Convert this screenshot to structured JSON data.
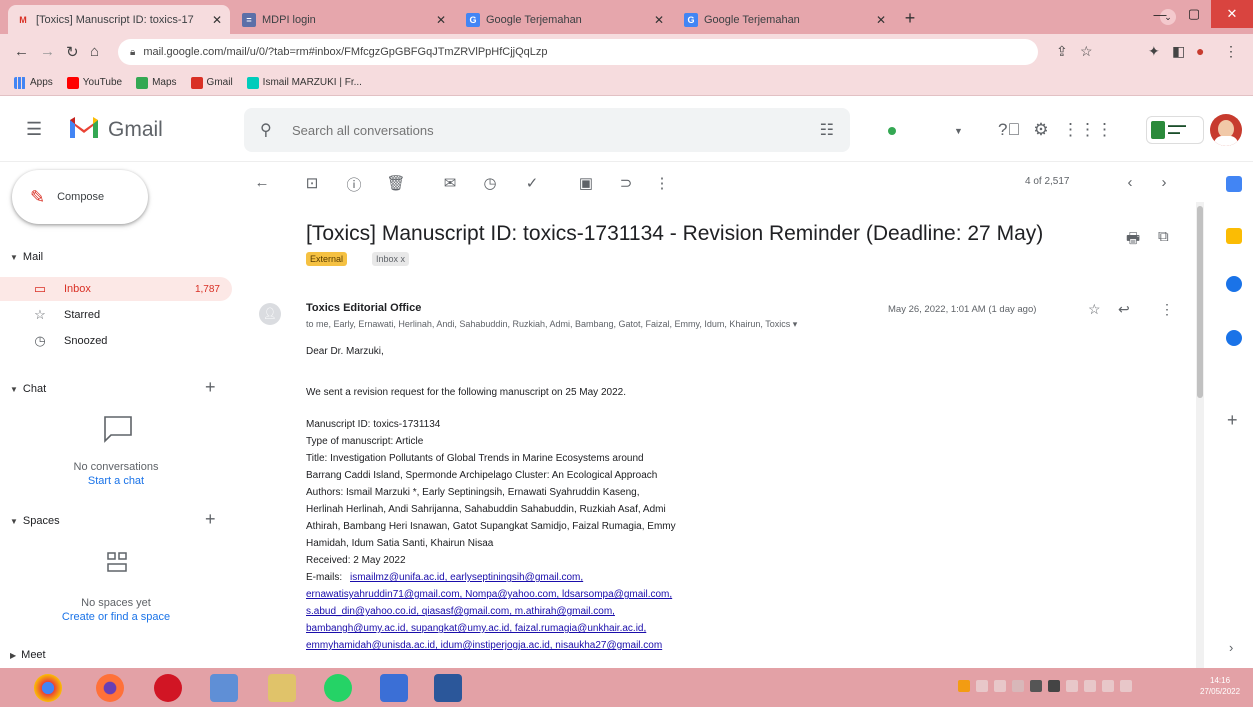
{
  "browser": {
    "tabs": [
      {
        "title": "[Toxics] Manuscript ID: toxics-17",
        "favicon": "gmail-favicon",
        "active": true
      },
      {
        "title": "MDPI login",
        "favicon": "mdpi-favicon",
        "active": false
      },
      {
        "title": "Google Terjemahan",
        "favicon": "translate-favicon",
        "active": false
      },
      {
        "title": "Google Terjemahan",
        "favicon": "translate-favicon",
        "active": false
      }
    ],
    "url": "mail.google.com/mail/u/0/?tab=rm#inbox/FMfcgzGpGBFGqJTmZRVlPpHfCjjQqLzp",
    "bookmarks": [
      "Apps",
      "YouTube",
      "Maps",
      "Gmail",
      "Ismail MARZUKI | Fr..."
    ]
  },
  "gmail": {
    "app_name": "Gmail",
    "search_placeholder": "Search all conversations",
    "compose_label": "Compose",
    "sections": {
      "mail": "Mail",
      "chat": "Chat",
      "spaces": "Spaces",
      "meet": "Meet"
    },
    "nav": [
      {
        "label": "Inbox",
        "count": "1,787",
        "icon": "inbox-icon"
      },
      {
        "label": "Starred",
        "count": "",
        "icon": "star-icon"
      },
      {
        "label": "Snoozed",
        "count": "",
        "icon": "clock-icon"
      }
    ],
    "chat_empty": {
      "text": "No conversations",
      "link": "Start a chat"
    },
    "spaces_empty": {
      "text": "No spaces yet",
      "link": "Create or find a space"
    },
    "pager": "4 of 2,517"
  },
  "message": {
    "subject": "[Toxics] Manuscript ID: toxics-1731134 - Revision Reminder (Deadline: 27 May)",
    "labels": [
      "External",
      "Inbox x"
    ],
    "sender": "Toxics Editorial Office",
    "recipients": "to me, Early, Ernawati, Herlinah, Andi, Sahabuddin, Ruzkiah, Admi, Bambang, Gatot, Faizal, Emmy, Idum, Khairun, Toxics",
    "date": "May 26, 2022, 1:01 AM (1 day ago)",
    "body": [
      "Dear Dr. Marzuki,",
      "We sent a revision request for the following manuscript on 25 May 2022.",
      "Manuscript ID: toxics-1731134",
      "Type of manuscript: Article",
      "Title: Investigation Pollutants of Global Trends in Marine Ecosystems around",
      "Barrang Caddi Island, Spermonde Archipelago Cluster: An Ecological Approach",
      "Authors: Ismail Marzuki *, Early Septiningsih, Ernawati Syahruddin Kaseng,",
      "Herlinah Herlinah, Andi Sahrijanna, Sahabuddin Sahabuddin, Ruzkiah Asaf, Admi",
      "Athirah, Bambang Heri Isnawan, Gatot Supangkat Samidjo, Faizal Rumagia, Emmy",
      "Hamidah, Idum Satia Santi, Khairun Nisaa",
      "Received: 2 May 2022"
    ],
    "emails_label": "E-mails:",
    "emails": [
      "ismailmz@unifa.ac.id, earlyseptiningsih@gmail.com,",
      "ernawatisyahruddin71@gmail.com, Nompa@yahoo.com, ldsarsompa@gmail.com,",
      "s.abud_din@yahoo.co.id, qiasasf@gmail.com, m.athirah@gmail.com,",
      "bambangh@umy.ac.id, supangkat@umy.ac.id, faizal.rumagia@unkhair.ac.id,",
      "emmyhamidah@unisda.ac.id, idum@instiperjogja.ac.id, nisaukha27@gmail.com"
    ]
  },
  "taskbar": {
    "time": "14:16",
    "date": "27/05/2022"
  },
  "colors": {
    "chrome_tabstrip": "#e6a6ac",
    "chrome_toolbar": "#f6dcde",
    "gmail_red": "#d93025",
    "inbox_active_bg": "#fce8e6",
    "external_label": "#f5c142",
    "link_blue": "#1a0dab",
    "taskbar": "#e3a1a6"
  }
}
